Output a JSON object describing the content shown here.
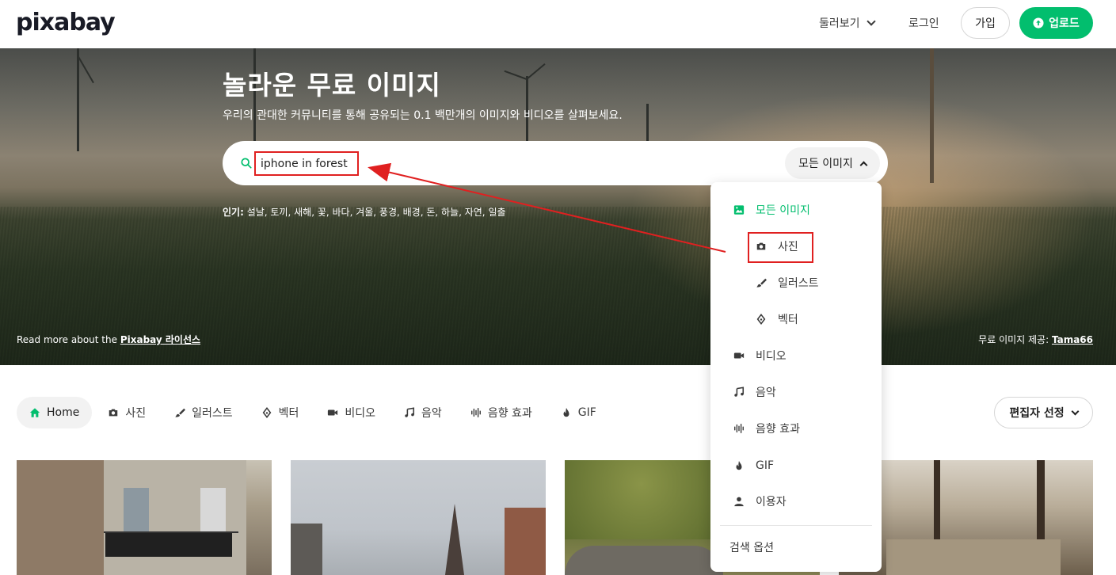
{
  "header": {
    "logo": "pixabay",
    "explore": "둘러보기",
    "login": "로그인",
    "join": "가입",
    "upload": "업로드"
  },
  "hero": {
    "title": "놀라운 무료 이미지",
    "subtitle": "우리의 관대한 커뮤니티를 통해 공유되는 0.1 백만개의 이미지와 비디오를 살펴보세요.",
    "search": {
      "value": "iphone in forest",
      "filter_label": "모든 이미지"
    },
    "popular_label": "인기:",
    "popular_terms": "설날, 토끼, 새해, 꽃, 바다, 겨울, 풍경, 배경, 돈, 하늘, 자연, 일출",
    "license_prefix": "Read more about the",
    "license_link": "Pixabay 라이선스",
    "credit_prefix": "무료 이미지 제공:",
    "credit_author": "Tama66"
  },
  "categories": {
    "home": "Home",
    "photo": "사진",
    "illustration": "일러스트",
    "vector": "벡터",
    "video": "비디오",
    "music": "음악",
    "sfx": "음향 효과",
    "gif": "GIF"
  },
  "sort": {
    "label": "편집자 선정"
  },
  "dropdown": {
    "all_images": "모든 이미지",
    "photo": "사진",
    "illustration": "일러스트",
    "vector": "벡터",
    "video": "비디오",
    "music": "음악",
    "sfx": "음향 효과",
    "gif": "GIF",
    "users": "이용자",
    "search_options": "검색 옵션"
  },
  "colors": {
    "accent": "#02be6e",
    "annotation": "#e02020"
  }
}
